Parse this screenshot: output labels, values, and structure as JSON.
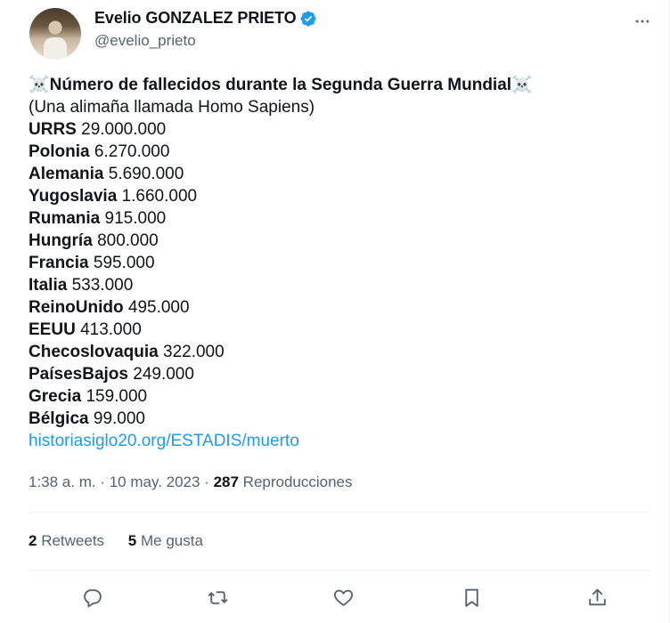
{
  "author": {
    "name": "Evelio GONZALEZ PRIETO",
    "handle": "@evelio_prieto"
  },
  "tweet": {
    "skull": "☠️",
    "title": "Número de fallecidos durante la Segunda Guerra Mundial",
    "subtitle": "(Una alimaña llamada Homo Sapiens)",
    "entries": [
      {
        "country": "URRS",
        "value": "29.000.000"
      },
      {
        "country": "Polonia",
        "value": "6.270.000"
      },
      {
        "country": "Alemania",
        "value": "5.690.000"
      },
      {
        "country": "Yugoslavia",
        "value": "1.660.000"
      },
      {
        "country": "Rumania",
        "value": "915.000"
      },
      {
        "country": "Hungría",
        "value": "800.000"
      },
      {
        "country": "Francia",
        "value": "595.000"
      },
      {
        "country": "Italia",
        "value": "533.000"
      },
      {
        "country": "ReinoUnido",
        "value": "495.000"
      },
      {
        "country": "EEUU",
        "value": "413.000"
      },
      {
        "country": "Checoslovaquia",
        "value": "322.000"
      },
      {
        "country": "PaísesBajos",
        "value": "249.000"
      },
      {
        "country": "Grecia",
        "value": "159.000"
      },
      {
        "country": "Bélgica",
        "value": "99.000"
      }
    ],
    "link": "historiasiglo20.org/ESTADIS/muerto"
  },
  "meta": {
    "time_date": "1:38 a. m. · 10 may. 2023 · ",
    "views_count": "287",
    "views_label": " Reproducciones"
  },
  "stats": {
    "retweets_count": "2",
    "retweets_label": " Retweets",
    "likes_count": "5",
    "likes_label": " Me gusta"
  },
  "icons": {
    "verified": "verified-badge-icon",
    "more": "more-dots-icon",
    "reply": "reply-icon",
    "retweet": "retweet-icon",
    "like": "heart-icon",
    "bookmark": "bookmark-icon",
    "share": "share-icon"
  },
  "colors": {
    "accent": "#1d9bf0",
    "text": "#0f1419",
    "secondary": "#536471"
  }
}
